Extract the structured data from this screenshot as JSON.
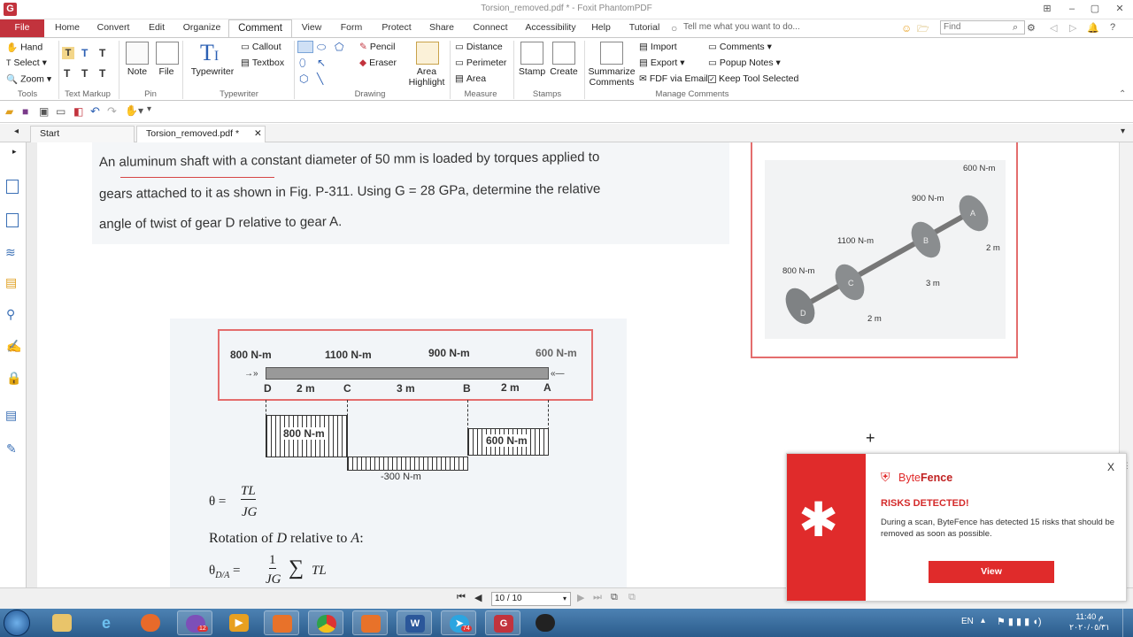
{
  "window": {
    "title": "Torsion_removed.pdf * - Foxit PhantomPDF",
    "app_logo": "G"
  },
  "tabs": [
    "File",
    "Home",
    "Convert",
    "Edit",
    "Organize",
    "Comment",
    "View",
    "Form",
    "Protect",
    "Share",
    "Connect",
    "Accessibility",
    "Help",
    "Tutorial"
  ],
  "active_tab": "Comment",
  "tell_me": "Tell me what you want to do...",
  "find_placeholder": "Find",
  "ribbon": {
    "tools": {
      "hand": "Hand",
      "select": "Select",
      "zoom": "Zoom",
      "group": "Tools"
    },
    "text_markup": {
      "group": "Text Markup"
    },
    "pin": {
      "note": "Note",
      "file": "File",
      "group": "Pin"
    },
    "typewriter": {
      "typewriter": "Typewriter",
      "callout": "Callout",
      "textbox": "Textbox",
      "group": "Typewriter"
    },
    "drawing": {
      "pencil": "Pencil",
      "eraser": "Eraser",
      "area_highlight_1": "Area",
      "area_highlight_2": "Highlight",
      "group": "Drawing"
    },
    "measure": {
      "distance": "Distance",
      "perimeter": "Perimeter",
      "area": "Area",
      "group": "Measure"
    },
    "stamps": {
      "stamp": "Stamp",
      "create": "Create",
      "group": "Stamps"
    },
    "manage": {
      "summarize_1": "Summarize",
      "summarize_2": "Comments",
      "import": "Import",
      "export": "Export",
      "fdf": "FDF via Email",
      "comments": "Comments",
      "popup_notes": "Popup Notes",
      "keep_tool": "Keep Tool Selected",
      "group": "Manage Comments"
    }
  },
  "doc_tabs": [
    {
      "label": "Start"
    },
    {
      "label": "Torsion_removed.pdf *"
    }
  ],
  "document": {
    "problem_line1": "An aluminum shaft with a constant diameter of 50 mm is loaded by torques applied to",
    "problem_line2": "gears attached to it as shown in Fig. P-311. Using G = 28 GPa, determine the relative",
    "problem_line3": "angle of twist of gear D relative to gear A.",
    "fig_torques": [
      "800 N-m",
      "1100 N-m",
      "900 N-m",
      "600 N-m"
    ],
    "fig_points": [
      "D",
      "C",
      "B",
      "A"
    ],
    "fig_lengths": [
      "2 m",
      "3 m",
      "2 m"
    ],
    "torque_diagram": [
      "800 N-m",
      "600 N-m",
      "-300 N-m"
    ],
    "eq_theta": "θ =",
    "eq_num": "TL",
    "eq_den": "JG",
    "rotation_text_1": "Rotation of ",
    "rotation_text_var": "D",
    "rotation_text_2": " relative to ",
    "rotation_text_var2": "A",
    "rotation_text_3": ":",
    "eq2_lhs": "θ",
    "eq2_sub": "D/A",
    "eq2_eq": "=",
    "eq2_num": "1",
    "eq2_den": "JG",
    "eq2_sum": "∑",
    "eq2_tl": "TL",
    "iso_torques": [
      "600 N-m",
      "900 N-m",
      "1100 N-m",
      "800 N-m"
    ],
    "iso_lengths": [
      "2 m",
      "3 m",
      "2 m"
    ],
    "iso_points": [
      "A",
      "B",
      "C",
      "D"
    ]
  },
  "status": {
    "page": "10 / 10"
  },
  "popup": {
    "brand_1": "Byte",
    "brand_2": "Fence",
    "heading": "RISKS DETECTED!",
    "body": "During a scan, ByteFence has detected 15 risks that should be removed as soon as possible.",
    "button": "View",
    "close": "X"
  },
  "taskbar": {
    "lang": "EN",
    "time": "11:40 م",
    "date": "٢٠٢٠/٠٥/٣١",
    "viber_badge": "12",
    "telegram_badge": "74"
  },
  "colors": {
    "accent": "#c2333d",
    "popup_red": "#e02b2b",
    "annotation_red": "#e46d6d"
  }
}
